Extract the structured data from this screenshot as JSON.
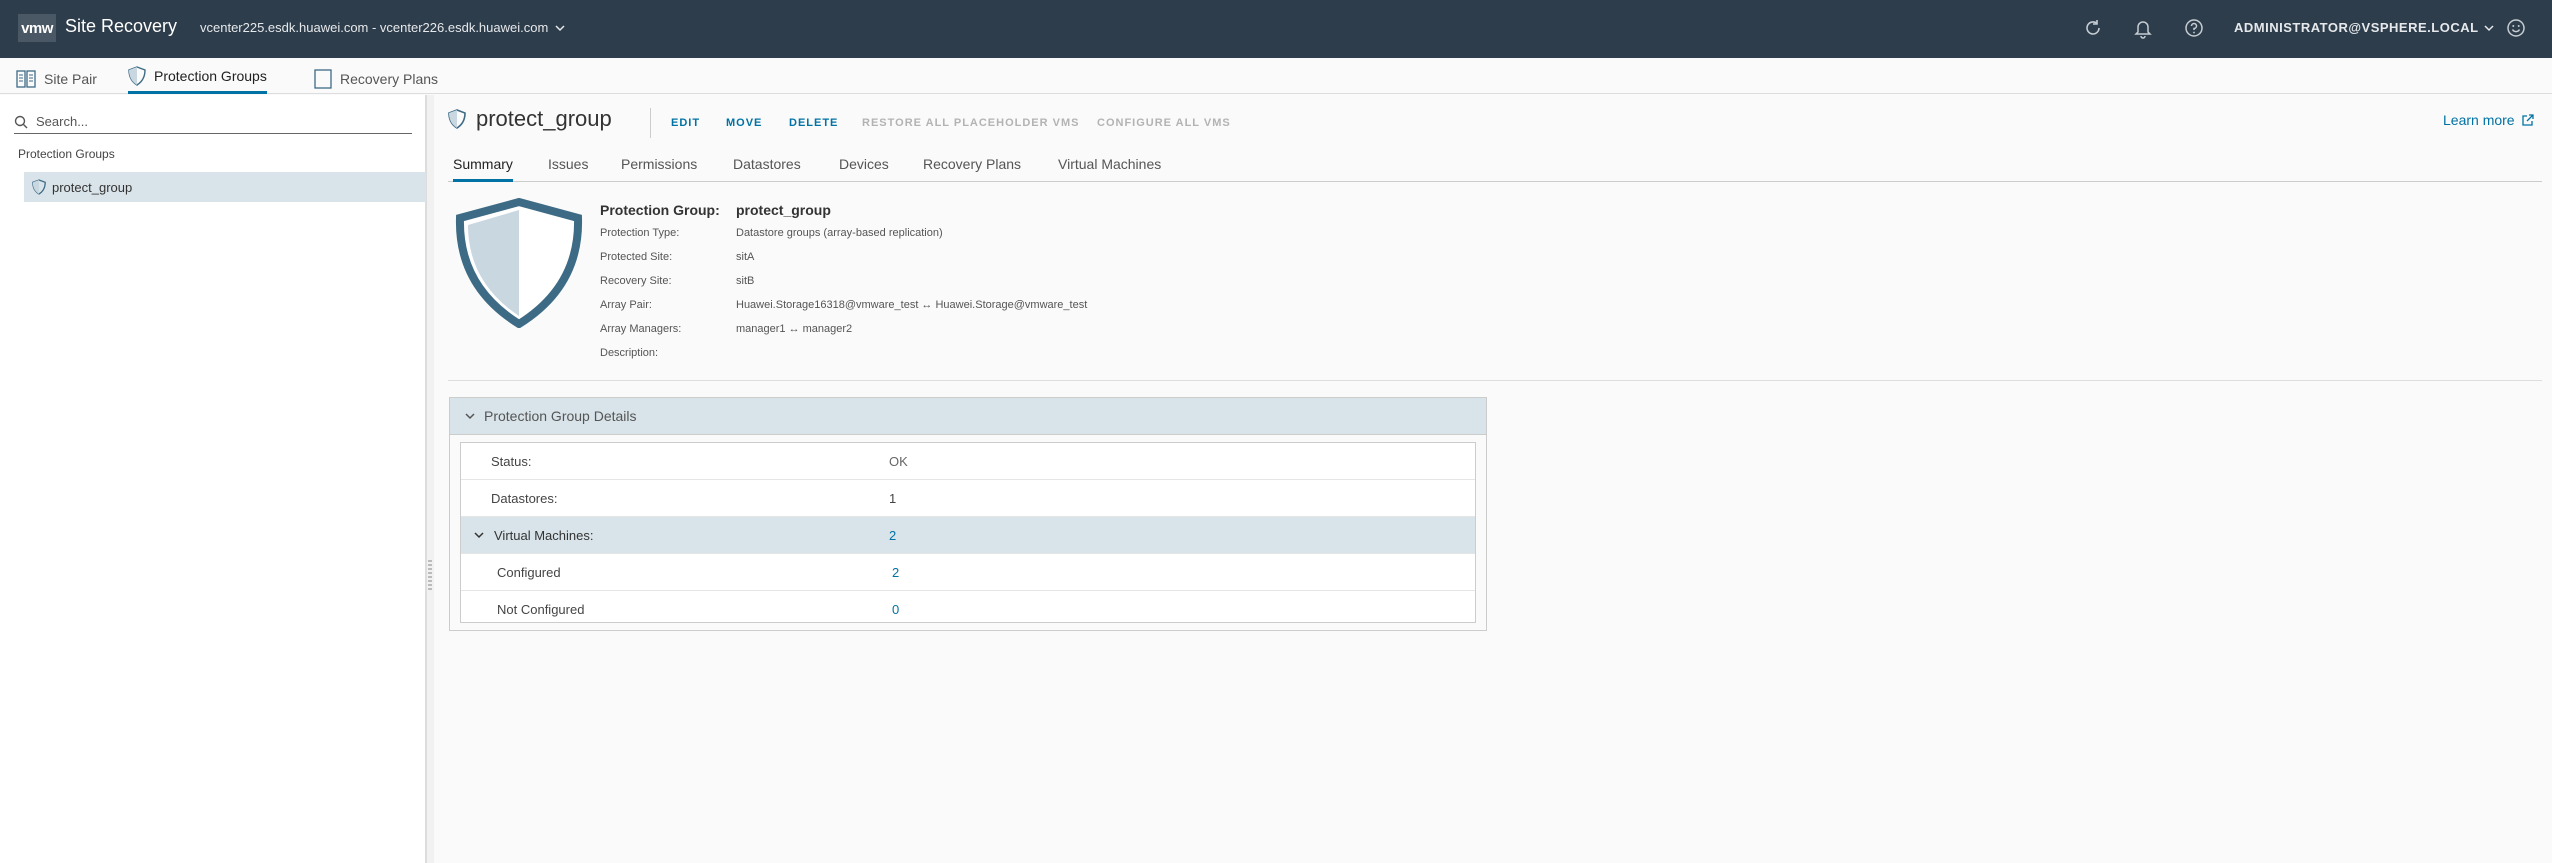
{
  "header": {
    "logo": "vmw",
    "app_title": "Site Recovery",
    "site_pair": "vcenter225.esdk.huawei.com - vcenter226.esdk.huawei.com",
    "user": "Administrator@VSPHERE.LOCAL",
    "icons": [
      "refresh-icon",
      "bell-icon",
      "help-icon",
      "smiley-icon"
    ]
  },
  "subnav": {
    "site_pair": "Site Pair",
    "protection_groups": "Protection Groups",
    "recovery_plans": "Recovery Plans"
  },
  "sidebar": {
    "search_placeholder": "Search...",
    "section_title": "Protection Groups",
    "items": [
      {
        "label": "protect_group"
      }
    ]
  },
  "main": {
    "title": "protect_group",
    "actions": {
      "edit": "EDIT",
      "move": "MOVE",
      "delete": "DELETE",
      "restore": "RESTORE ALL PLACEHOLDER VMS",
      "configure": "CONFIGURE ALL VMS"
    },
    "learn_more": "Learn more",
    "tabs": [
      "Summary",
      "Issues",
      "Permissions",
      "Datastores",
      "Devices",
      "Recovery Plans",
      "Virtual Machines"
    ]
  },
  "summary": {
    "group_label": "Protection Group:",
    "group_value": "protect_group",
    "rows": [
      {
        "label": "Protection Type:",
        "value": "Datastore groups (array-based replication)"
      },
      {
        "label": "Protected Site:",
        "value": "sitA"
      },
      {
        "label": "Recovery Site:",
        "value": "sitB"
      },
      {
        "label": "Array Pair:",
        "value": "Huawei.Storage16318@vmware_test ↔ Huawei.Storage@vmware_test"
      },
      {
        "label": "Array Managers:",
        "value": "manager1 ↔ manager2"
      },
      {
        "label": "Description:",
        "value": ""
      }
    ]
  },
  "details": {
    "title": "Protection Group Details",
    "status_label": "Status:",
    "status_value": "OK",
    "datastores_label": "Datastores:",
    "datastores_value": "1",
    "vms_label": "Virtual Machines:",
    "vms_value": "2",
    "configured_label": "Configured",
    "configured_value": "2",
    "not_configured_label": "Not Configured",
    "not_configured_value": "0"
  },
  "colors": {
    "header_bg": "#2e3d4b",
    "accent": "#0072a3",
    "selected_bg": "#d9e4ea",
    "shield": "#3d6b85"
  }
}
